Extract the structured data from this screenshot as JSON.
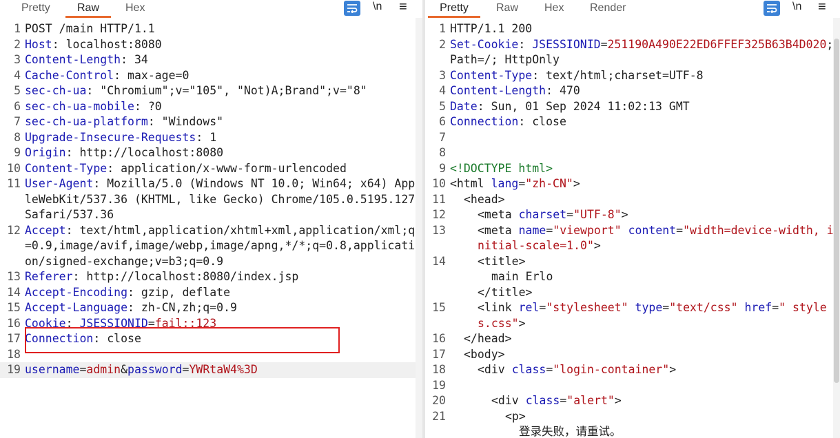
{
  "request": {
    "tabs": [
      {
        "label": "Pretty",
        "active": false
      },
      {
        "label": "Raw",
        "active": true
      },
      {
        "label": "Hex",
        "active": false
      }
    ],
    "newline_toggle": "\\n",
    "menu_icon": "≡",
    "lines": [
      {
        "n": "1",
        "text": "POST /main HTTP/1.1"
      },
      {
        "n": "2",
        "name": "Host",
        "value": " localhost:8080"
      },
      {
        "n": "3",
        "name": "Content-Length",
        "value": " 34"
      },
      {
        "n": "4",
        "name": "Cache-Control",
        "value": " max-age=0"
      },
      {
        "n": "5",
        "name": "sec-ch-ua",
        "value": " \"Chromium\";v=\"105\", \"Not)A;Brand\";v=\"8\""
      },
      {
        "n": "6",
        "name": "sec-ch-ua-mobile",
        "value": " ?0"
      },
      {
        "n": "7",
        "name": "sec-ch-ua-platform",
        "value": " \"Windows\""
      },
      {
        "n": "8",
        "name": "Upgrade-Insecure-Requests",
        "value": " 1"
      },
      {
        "n": "9",
        "name": "Origin",
        "value": " http://localhost:8080"
      },
      {
        "n": "10",
        "name": "Content-Type",
        "value": " application/x-www-form-urlencoded"
      },
      {
        "n": "11",
        "name": "User-Agent",
        "value": " Mozilla/5.0 (Windows NT 10.0; Win64; x64) AppleWebKit/537.36 (KHTML, like Gecko) Chrome/105.0.5195.127 Safari/537.36"
      },
      {
        "n": "12",
        "name": "Accept",
        "value": " text/html,application/xhtml+xml,application/xml;q=0.9,image/avif,image/webp,image/apng,*/*;q=0.8,application/signed-exchange;v=b3;q=0.9"
      },
      {
        "n": "13",
        "name": "Referer",
        "value": " http://localhost:8080/index.jsp"
      },
      {
        "n": "14",
        "name": "Accept-Encoding",
        "value": " gzip, deflate"
      },
      {
        "n": "15",
        "name": "Accept-Language",
        "value": " zh-CN,zh;q=0.9"
      },
      {
        "n": "16",
        "name": "Cookie",
        "value": " ",
        "cookie_name": "JSESSIONID",
        "cookie_eq": "=",
        "cookie_value": "fail::123"
      },
      {
        "n": "17",
        "name": "Connection",
        "value": " close"
      },
      {
        "n": "18",
        "text": ""
      },
      {
        "n": "19",
        "body_k1": "username",
        "body_eq1": "=",
        "body_v1": "admin",
        "body_amp": "&",
        "body_k2": "password",
        "body_eq2": "=",
        "body_v2": "YWRtaW4%3D"
      }
    ]
  },
  "response": {
    "tabs": [
      {
        "label": "Pretty",
        "active": true
      },
      {
        "label": "Raw",
        "active": false
      },
      {
        "label": "Hex",
        "active": false
      },
      {
        "label": "Render",
        "active": false
      }
    ],
    "newline_toggle": "\\n",
    "menu_icon": "≡",
    "status_line": "HTTP/1.1 200",
    "set_cookie": {
      "name": "Set-Cookie",
      "cookie_name": "JSESSIONID",
      "eq": "=",
      "cookie_value": "251190A490E22ED6FFEF325B63B4D020",
      "rest": "; Path=/; HttpOnly"
    },
    "headers": [
      {
        "n": "3",
        "name": "Content-Type",
        "value": " text/html;charset=UTF-8"
      },
      {
        "n": "4",
        "name": "Content-Length",
        "value": " 470"
      },
      {
        "n": "5",
        "name": "Date",
        "value": " Sun, 01 Sep 2024 11:02:13 GMT"
      },
      {
        "n": "6",
        "name": "Connection",
        "value": " close"
      }
    ],
    "html": {
      "doctype": "<!DOCTYPE html>",
      "html_open": "<html",
      "lang_attr": "lang",
      "lang_val": "\"zh-CN\"",
      "head_open": "<head>",
      "meta_open": "<meta",
      "charset_attr": "charset",
      "charset_val": "\"UTF-8\"",
      "name_attr": "name",
      "name_val": "\"viewport\"",
      "content_attr": "content",
      "content_val": "\"width=device-width, initial-scale=1.0\"",
      "title_open": "<title>",
      "title_text": "main Erlo",
      "title_close": "</title>",
      "link_open": "<link",
      "rel_attr": "rel",
      "rel_val": "\"stylesheet\"",
      "type_attr": "type",
      "type_val": "\"text/css\"",
      "href_attr": "href",
      "href_val": "\" styles.css\"",
      "head_close": "</head>",
      "body_open": "<body>",
      "div_open": "<div",
      "class_attr": "class",
      "class_val1": "\"login-container\"",
      "class_val2": "\"alert\"",
      "p_open": "<p>",
      "alert_text": "登录失败，请重试。",
      "gt": ">",
      "eq": "="
    }
  }
}
